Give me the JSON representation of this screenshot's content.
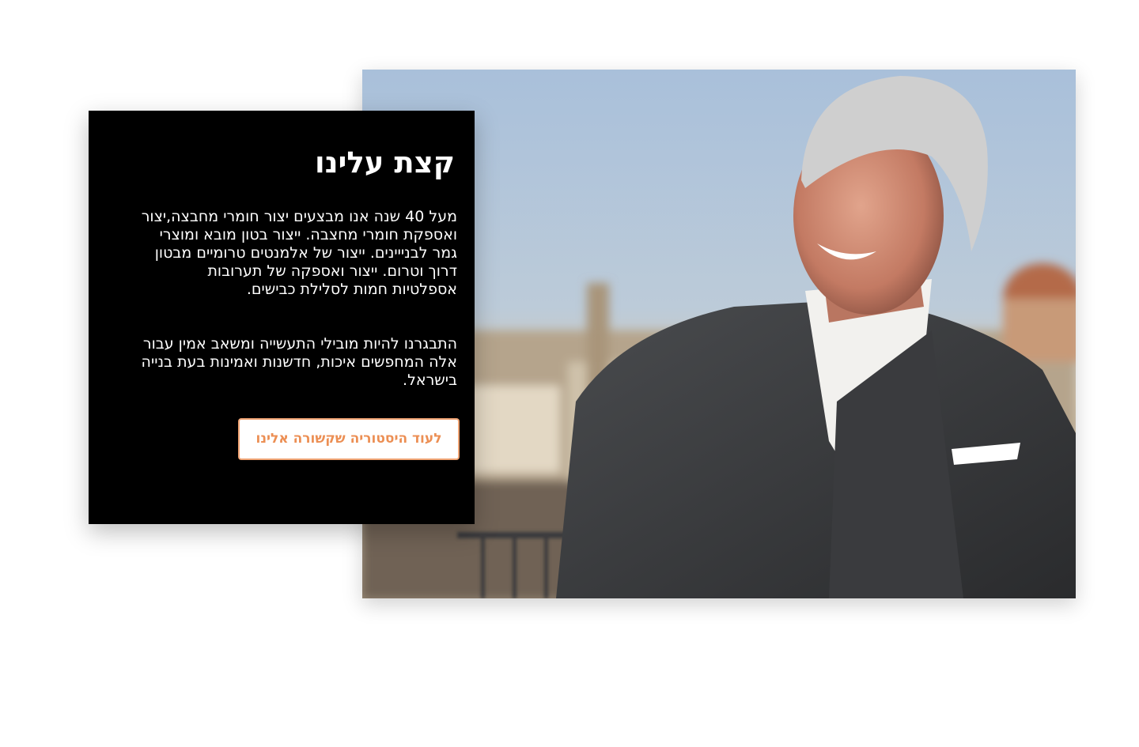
{
  "about": {
    "title": "קצת עלינו",
    "paragraph_1": "מעל 40 שנה אנו מבצעים יצור חומרי מחבצה,יצור ואספקת חומרי מחצבה. ייצור בטון מובא ומוצרי גמר לבנייינים. ייצור של אלמנטים טרומיים מבטון דרוך וטרום. ייצור ואספקה של תערובות אספלטיות חמות לסלילת כבישים.",
    "paragraph_2": "התבגרנו להיות מובילי התעשייה ומשאב אמין עבור אלה המחפשים איכות, חדשנות ואמינות בעת בנייה בישראל.",
    "cta_label": "לעוד היסטוריה שקשורה אלינו"
  },
  "colors": {
    "card_background": "#000000",
    "accent": "#ec8f54",
    "page_background": "#ffffff"
  }
}
